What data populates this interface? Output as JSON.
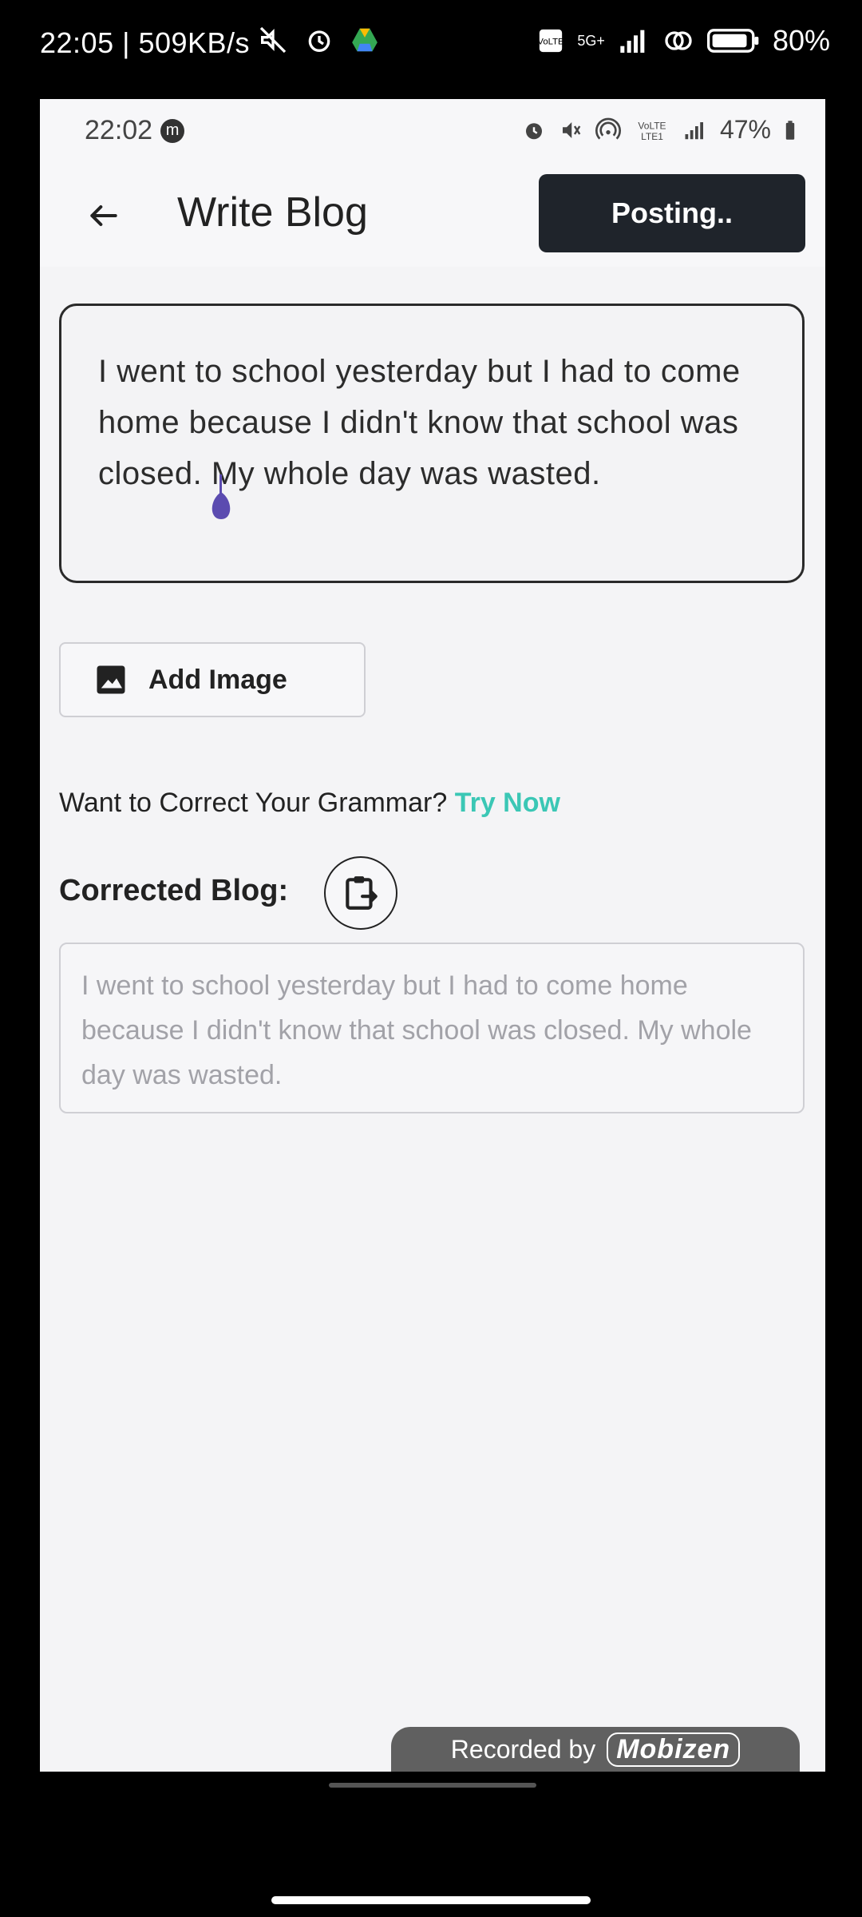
{
  "device_status": {
    "time": "22:05",
    "speed": "| 509KB/s",
    "network": "5G+",
    "battery": "80%",
    "icons": [
      "mute-icon",
      "alarm-icon",
      "drive-icon",
      "volte-icon",
      "signal-icon",
      "hotspot-icon",
      "battery-icon"
    ]
  },
  "app_status": {
    "time": "22:02",
    "battery": "47%",
    "icons": [
      "messenger-icon",
      "alarm-icon",
      "mute-icon",
      "hotspot-icon",
      "volte-icon",
      "signal-icon"
    ]
  },
  "appbar": {
    "title": "Write Blog",
    "post_button": "Posting.."
  },
  "editor": {
    "text": "I went to school yesterday but I had to come home because I didn't know that school was closed. My whole day was wasted."
  },
  "add_image": {
    "label": "Add Image"
  },
  "grammar": {
    "prompt": "Want to Correct Your Grammar?",
    "link": "Try Now"
  },
  "corrected": {
    "label": "Corrected Blog:",
    "text": "I went to school yesterday but I had to come home because I didn't know that school was closed. My whole day was wasted."
  },
  "watermark": {
    "prefix": "Recorded by",
    "brand": "Mobizen"
  },
  "colors": {
    "accent_link": "#3bc7b5",
    "button_dark": "#1f242b",
    "cursor": "#5b4bb0"
  }
}
